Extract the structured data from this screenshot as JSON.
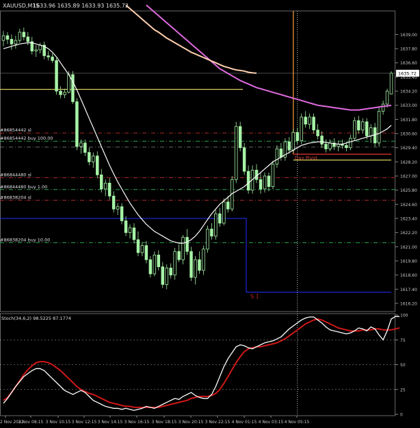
{
  "window": {
    "title": "XAUUSD,M15",
    "ohlc": "1633.96 1635.89 1633.93 1635.72"
  },
  "colors": {
    "background": "#000000",
    "grid": "#3a3a3a",
    "axis_text": "#c8c8c8",
    "candle": "#a6f2a6",
    "ma_fast": "#ffffff",
    "ma_mid": "#e06be0",
    "ma_slow": "#ffd0b0",
    "pivot": "#ffa040",
    "sl_line": "#c03030",
    "buy_line": "#30c060",
    "yellow_line": "#d8d060",
    "blue_level": "#2030ff",
    "stoch_main": "#ffffff",
    "stoch_signal": "#d01818",
    "price_label_bg": "#ffffff"
  },
  "chart_data": [
    {
      "type": "candlestick",
      "panel": "price",
      "ylim": [
        1615.5,
        1641.0
      ],
      "y_ticks": [
        1616.2,
        1617.4,
        1618.6,
        1619.8,
        1621.0,
        1622.2,
        1623.4,
        1624.6,
        1625.8,
        1627.0,
        1628.2,
        1629.4,
        1630.6,
        1631.8,
        1633.0,
        1634.2,
        1635.4,
        1636.6,
        1637.8,
        1639.0
      ],
      "current_price": 1635.72,
      "current_price_label": "1635.72",
      "x_labels": [
        "2 Nov 2022",
        "3 Nov 08:15",
        "3 Nov 10:15",
        "3 Nov 12:15",
        "3 Nov 14:15",
        "3 Nov 16:15",
        "3 Nov 18:15",
        "3 Nov 20:15",
        "3 Nov 22:15",
        "4 Nov 01:15",
        "4 Nov 03:15",
        "4 Nov 05:15"
      ],
      "candles": [
        [
          1638.5,
          1639.3,
          1638.0,
          1638.9
        ],
        [
          1638.9,
          1639.2,
          1638.2,
          1638.6
        ],
        [
          1638.6,
          1639.0,
          1637.7,
          1638.2
        ],
        [
          1638.2,
          1638.9,
          1637.8,
          1638.5
        ],
        [
          1638.5,
          1639.5,
          1638.3,
          1639.2
        ],
        [
          1639.2,
          1639.6,
          1638.5,
          1638.8
        ],
        [
          1638.8,
          1639.2,
          1638.1,
          1638.4
        ],
        [
          1638.4,
          1638.8,
          1637.3,
          1637.6
        ],
        [
          1637.6,
          1638.1,
          1637.1,
          1637.7
        ],
        [
          1637.7,
          1638.3,
          1637.4,
          1638.1
        ],
        [
          1638.1,
          1638.4,
          1636.9,
          1637.2
        ],
        [
          1637.2,
          1637.6,
          1636.8,
          1637.1
        ],
        [
          1637.1,
          1637.4,
          1636.6,
          1636.8
        ],
        [
          1636.8,
          1637.0,
          1633.9,
          1634.2
        ],
        [
          1634.2,
          1634.6,
          1633.6,
          1633.9
        ],
        [
          1633.9,
          1634.4,
          1633.6,
          1634.1
        ],
        [
          1634.1,
          1635.9,
          1634.0,
          1635.6
        ],
        [
          1635.6,
          1635.9,
          1633.1,
          1633.3
        ],
        [
          1633.3,
          1633.6,
          1629.2,
          1629.5
        ],
        [
          1629.5,
          1630.1,
          1628.9,
          1629.8
        ],
        [
          1629.8,
          1630.1,
          1628.7,
          1629.0
        ],
        [
          1629.0,
          1629.4,
          1627.9,
          1628.2
        ],
        [
          1628.2,
          1629.0,
          1627.7,
          1628.7
        ],
        [
          1628.7,
          1629.1,
          1626.8,
          1627.1
        ],
        [
          1627.1,
          1627.6,
          1625.6,
          1625.9
        ],
        [
          1625.9,
          1626.7,
          1625.3,
          1626.4
        ],
        [
          1626.4,
          1626.8,
          1625.0,
          1625.3
        ],
        [
          1625.3,
          1625.7,
          1623.9,
          1624.2
        ],
        [
          1624.2,
          1624.7,
          1623.7,
          1624.4
        ],
        [
          1624.4,
          1624.7,
          1622.9,
          1623.2
        ],
        [
          1623.2,
          1623.6,
          1621.9,
          1622.2
        ],
        [
          1622.2,
          1622.9,
          1621.7,
          1622.6
        ],
        [
          1622.6,
          1623.0,
          1621.3,
          1621.6
        ],
        [
          1621.6,
          1622.3,
          1620.2,
          1620.5
        ],
        [
          1620.5,
          1621.4,
          1620.2,
          1621.1
        ],
        [
          1621.1,
          1621.5,
          1619.6,
          1619.9
        ],
        [
          1619.9,
          1620.2,
          1618.4,
          1618.7
        ],
        [
          1618.7,
          1620.6,
          1618.5,
          1620.3
        ],
        [
          1620.3,
          1620.7,
          1619.0,
          1619.3
        ],
        [
          1619.3,
          1619.7,
          1617.5,
          1617.8
        ],
        [
          1617.8,
          1619.5,
          1617.4,
          1619.2
        ],
        [
          1619.2,
          1619.6,
          1618.3,
          1618.6
        ],
        [
          1618.6,
          1620.9,
          1618.2,
          1620.6
        ],
        [
          1620.6,
          1621.2,
          1619.7,
          1619.9
        ],
        [
          1619.9,
          1622.0,
          1619.5,
          1621.8
        ],
        [
          1621.8,
          1622.5,
          1620.3,
          1620.6
        ],
        [
          1620.6,
          1621.0,
          1618.1,
          1618.4
        ],
        [
          1618.4,
          1620.2,
          1617.8,
          1619.9
        ],
        [
          1619.9,
          1620.6,
          1618.7,
          1619.0
        ],
        [
          1619.0,
          1621.1,
          1618.6,
          1620.8
        ],
        [
          1620.8,
          1622.8,
          1620.5,
          1622.5
        ],
        [
          1622.5,
          1623.0,
          1621.6,
          1621.9
        ],
        [
          1621.9,
          1624.1,
          1621.6,
          1623.8
        ],
        [
          1623.8,
          1624.3,
          1622.7,
          1623.0
        ],
        [
          1623.0,
          1625.1,
          1622.8,
          1624.8
        ],
        [
          1624.8,
          1625.3,
          1623.9,
          1624.2
        ],
        [
          1624.2,
          1627.0,
          1624.0,
          1626.7
        ],
        [
          1626.7,
          1631.6,
          1626.4,
          1631.2
        ],
        [
          1631.2,
          1631.6,
          1629.1,
          1629.4
        ],
        [
          1629.4,
          1629.8,
          1627.1,
          1627.4
        ],
        [
          1627.4,
          1627.9,
          1625.5,
          1625.8
        ],
        [
          1625.8,
          1627.9,
          1625.5,
          1627.5
        ],
        [
          1627.5,
          1628.0,
          1626.4,
          1626.7
        ],
        [
          1626.7,
          1627.3,
          1625.5,
          1625.9
        ],
        [
          1625.9,
          1627.3,
          1625.6,
          1627.0
        ],
        [
          1627.0,
          1627.3,
          1625.7,
          1626.1
        ],
        [
          1626.1,
          1628.3,
          1625.9,
          1628.0
        ],
        [
          1628.0,
          1629.6,
          1627.7,
          1629.3
        ],
        [
          1629.3,
          1629.8,
          1628.3,
          1628.6
        ],
        [
          1628.6,
          1630.2,
          1628.3,
          1629.9
        ],
        [
          1629.9,
          1630.3,
          1628.9,
          1629.2
        ],
        [
          1629.2,
          1631.0,
          1629.0,
          1630.7
        ],
        [
          1630.7,
          1631.1,
          1629.7,
          1630.0
        ],
        [
          1630.0,
          1632.3,
          1629.7,
          1632.0
        ],
        [
          1632.0,
          1632.5,
          1631.1,
          1631.4
        ],
        [
          1631.4,
          1632.3,
          1631.0,
          1632.0
        ],
        [
          1632.0,
          1632.3,
          1630.6,
          1630.9
        ],
        [
          1630.9,
          1631.4,
          1630.1,
          1630.4
        ],
        [
          1630.4,
          1630.8,
          1629.4,
          1629.7
        ],
        [
          1629.7,
          1630.1,
          1629.0,
          1629.3
        ],
        [
          1629.3,
          1630.1,
          1629.1,
          1629.8
        ],
        [
          1629.8,
          1630.2,
          1629.2,
          1629.5
        ],
        [
          1629.5,
          1630.0,
          1629.1,
          1629.7
        ],
        [
          1629.7,
          1630.1,
          1629.3,
          1629.6
        ],
        [
          1629.6,
          1629.9,
          1629.1,
          1629.4
        ],
        [
          1629.4,
          1630.5,
          1629.2,
          1630.2
        ],
        [
          1630.2,
          1632.0,
          1630.0,
          1631.7
        ],
        [
          1631.7,
          1632.1,
          1630.6,
          1630.9
        ],
        [
          1630.9,
          1631.9,
          1630.6,
          1631.6
        ],
        [
          1631.6,
          1631.9,
          1630.1,
          1630.4
        ],
        [
          1630.4,
          1631.4,
          1629.8,
          1631.1
        ],
        [
          1631.1,
          1631.5,
          1629.5,
          1629.8
        ],
        [
          1629.8,
          1632.8,
          1629.5,
          1632.5
        ],
        [
          1632.5,
          1633.4,
          1632.2,
          1633.1
        ],
        [
          1633.1,
          1634.4,
          1632.8,
          1634.2
        ],
        [
          1633.96,
          1635.89,
          1633.93,
          1635.72
        ]
      ]
    },
    {
      "type": "line",
      "panel": "price",
      "series": [
        {
          "role": "ma_fast",
          "values": [
            1637.8,
            1637.9,
            1638.0,
            1638.1,
            1638.2,
            1638.25,
            1638.3,
            1638.3,
            1638.2,
            1638.1,
            1638.0,
            1637.8,
            1637.5,
            1637.1,
            1636.6,
            1636.1,
            1635.6,
            1635.0,
            1634.3,
            1633.5,
            1632.7,
            1631.9,
            1631.1,
            1630.3,
            1629.5,
            1628.7,
            1627.9,
            1627.2,
            1626.5,
            1625.9,
            1625.3,
            1624.7,
            1624.2,
            1623.7,
            1623.3,
            1622.9,
            1622.6,
            1622.3,
            1622.1,
            1621.9,
            1621.7,
            1621.5,
            1621.4,
            1621.3,
            1621.3,
            1621.4,
            1621.6,
            1621.9,
            1622.3,
            1622.8,
            1623.3,
            1623.8,
            1624.2,
            1624.6,
            1624.9,
            1625.2,
            1625.5,
            1625.7,
            1625.9,
            1626.1,
            1626.4,
            1626.7,
            1627.0,
            1627.3,
            1627.6,
            1627.9,
            1628.2,
            1628.4,
            1628.6,
            1628.8,
            1629.0,
            1629.2,
            1629.4,
            1629.6,
            1629.7,
            1629.8,
            1629.85,
            1629.9,
            1629.9,
            1629.85,
            1629.8,
            1629.75,
            1629.7,
            1629.7,
            1629.8,
            1629.9,
            1630.0,
            1630.1,
            1630.2,
            1630.3,
            1630.4,
            1630.5,
            1630.6,
            1630.8,
            1631.0,
            1631.3
          ]
        },
        {
          "role": "ma_mid",
          "values": [
            1641.5,
            1641.2,
            1640.9,
            1640.6,
            1640.3,
            1640.0,
            1639.7,
            1639.4,
            1639.1,
            1638.8,
            1638.5,
            1638.2,
            1637.9,
            1637.6,
            1637.3,
            1637.0,
            1636.7,
            1636.4,
            1636.1,
            1635.9,
            1635.7,
            1635.5,
            1635.3,
            1635.1,
            1634.95,
            1634.8,
            1634.65,
            1634.5,
            1634.4,
            1634.3,
            1634.2,
            1634.1,
            1634.0,
            1633.9,
            1633.8,
            1633.7,
            1633.6,
            1633.5,
            1633.4,
            1633.3,
            1633.2,
            1633.1,
            1633.0,
            1632.95,
            1632.9,
            1632.85,
            1632.8,
            1632.75,
            1632.7,
            1632.65,
            1632.6,
            1632.6,
            1632.6,
            1632.65,
            1632.7,
            1632.75,
            1632.8,
            1632.85,
            1632.9,
            1632.95,
            1633.0
          ]
        },
        {
          "role": "ma_slow",
          "values": [
            1641.5,
            1641.2,
            1640.9,
            1640.6,
            1640.3,
            1640.0,
            1639.7,
            1639.4,
            1639.2,
            1638.95,
            1638.7,
            1638.5,
            1638.3,
            1638.1,
            1637.9,
            1637.7,
            1637.5,
            1637.35,
            1637.2,
            1637.05,
            1636.9,
            1636.75,
            1636.6,
            1636.45,
            1636.3,
            1636.2,
            1636.1,
            1636.0,
            1635.95,
            1635.9,
            1635.8,
            1635.75,
            1635.72
          ]
        }
      ],
      "ma_slow_start_index": 30,
      "ma_mid_start_index": 35
    },
    {
      "type": "level_lines",
      "panel": "price",
      "lines": [
        {
          "role": "sl",
          "price": 1630.65,
          "label": "#86854442 sl"
        },
        {
          "role": "buy",
          "price": 1629.95,
          "label": "#86854442 buy 100.00"
        },
        {
          "role": "sl",
          "price": 1626.85,
          "label": "#86844480 sl"
        },
        {
          "role": "buy",
          "price": 1625.85,
          "label": "#86844480 buy 1.00"
        },
        {
          "role": "sl",
          "price": 1624.95,
          "label": "#86838204 sl"
        },
        {
          "role": "buy",
          "price": 1621.35,
          "label": "#86838204 buy 10.00"
        }
      ],
      "dashdot_extra": 1629.45,
      "yellow_price": 1634.35,
      "pivot_price": 1628.85,
      "pivot_label": "Day Pivot",
      "pivot2_price": 1628.35,
      "s1_price": 1617.15,
      "s1_label": "S 1",
      "blue_price": 1623.4,
      "current_label_price": 1635.72
    },
    {
      "type": "line",
      "panel": "stochastic",
      "title": "Stoch(34,6,2) 98.5225 87.1774",
      "ylim": [
        0,
        100
      ],
      "y_ticks": [
        0,
        25,
        50,
        75,
        100
      ],
      "levels": [
        25,
        50,
        75
      ],
      "series": [
        {
          "role": "stoch_main",
          "values": [
            11,
            16,
            22,
            28,
            33,
            38,
            41,
            44,
            46,
            46,
            44,
            40,
            36,
            32,
            28,
            24,
            22,
            20,
            22,
            24,
            22,
            18,
            14,
            12,
            10,
            8,
            7,
            6,
            6,
            5,
            6,
            5,
            4,
            5,
            6,
            8,
            7,
            6,
            8,
            10,
            12,
            14,
            16,
            15,
            18,
            20,
            22,
            19,
            17,
            16,
            16,
            20,
            28,
            38,
            48,
            56,
            62,
            68,
            70,
            69,
            67,
            66,
            68,
            70,
            72,
            73,
            74,
            76,
            78,
            82,
            86,
            89,
            92,
            95,
            97,
            98,
            98,
            95,
            92,
            88,
            85,
            84,
            83,
            82,
            81,
            82,
            84,
            87,
            86,
            84,
            88,
            86,
            80,
            75,
            84,
            96,
            98.5,
            98.5
          ]
        },
        {
          "role": "stoch_signal",
          "values": [
            14,
            17,
            22,
            28,
            34,
            40,
            45,
            49,
            52,
            53,
            53,
            52,
            50,
            47,
            44,
            40,
            36,
            32,
            28,
            25,
            23,
            21,
            20,
            18,
            16,
            14,
            12,
            11,
            10,
            9,
            8,
            8,
            7,
            7,
            7,
            7,
            7,
            7,
            7,
            8,
            9,
            10,
            11,
            12,
            13,
            14,
            16,
            17,
            18,
            18,
            18,
            19,
            21,
            25,
            31,
            38,
            45,
            52,
            58,
            63,
            66,
            67,
            68,
            68,
            69,
            70,
            71,
            72,
            74,
            76,
            79,
            82,
            85,
            88,
            91,
            93,
            95,
            96,
            95,
            93,
            91,
            89,
            87,
            86,
            85,
            84,
            84,
            84,
            85,
            85,
            85,
            86,
            86,
            85,
            85,
            85,
            86,
            87
          ]
        }
      ]
    }
  ]
}
